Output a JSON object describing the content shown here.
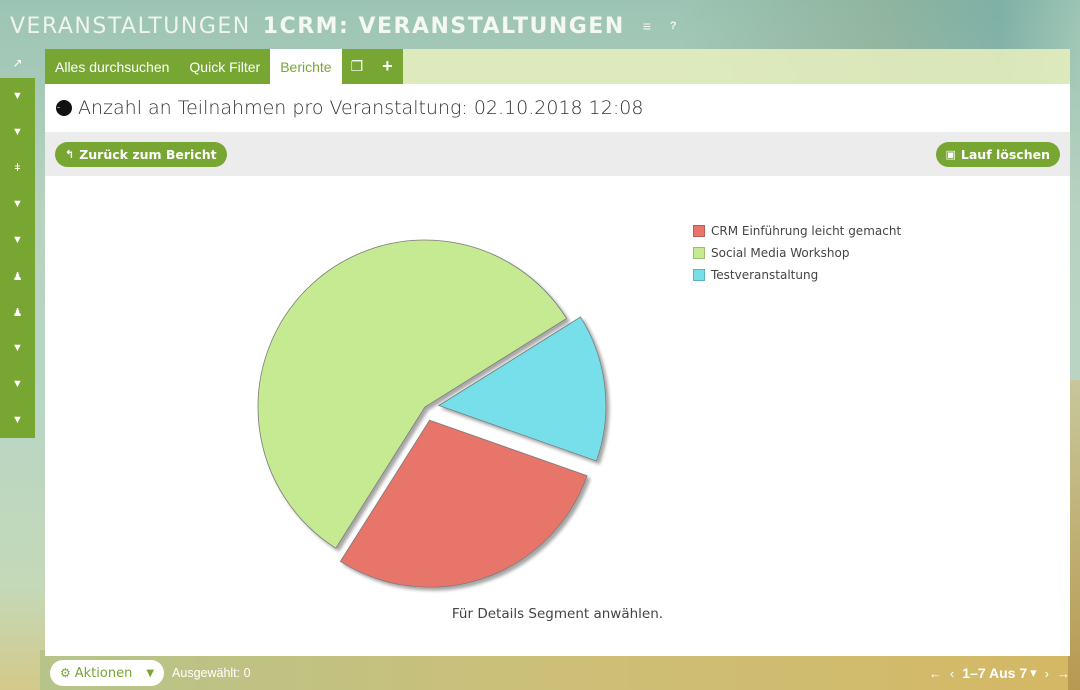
{
  "title": {
    "module": "VERANSTALTUNGEN",
    "record": "1CRM: VERANSTALTUNGEN",
    "menu_icon": "≡",
    "help_icon": "?"
  },
  "sidebar": {
    "top_icon": "↗",
    "items": [
      {
        "icon": "pizza-slice",
        "glyph": "▼"
      },
      {
        "icon": "pizza-slice",
        "glyph": "▼"
      },
      {
        "icon": "pin",
        "glyph": "ǂ"
      },
      {
        "icon": "pizza-slice",
        "glyph": "▼"
      },
      {
        "icon": "pizza-slice",
        "glyph": "▼"
      },
      {
        "icon": "user",
        "glyph": "♟"
      },
      {
        "icon": "user",
        "glyph": "♟"
      },
      {
        "icon": "pizza-slice",
        "glyph": "▼"
      },
      {
        "icon": "pizza-slice",
        "glyph": "▼"
      },
      {
        "icon": "pizza-slice",
        "glyph": "▼"
      }
    ]
  },
  "tabs": {
    "search": "Alles durchsuchen",
    "quick_filter": "Quick Filter",
    "reports": "Berichte",
    "window_icon": "❐",
    "add_icon": "+"
  },
  "header": {
    "title": "Anzahl an Teilnahmen pro Veranstaltung: 02.10.2018 12:08"
  },
  "toolbar": {
    "back_label": "Zurück zum Bericht",
    "back_icon": "↰",
    "delete_label": "Lauf löschen",
    "delete_icon": "🗑"
  },
  "hint": "Für Details Segment anwählen.",
  "footer": {
    "actions_label": "Aktionen",
    "actions_icon": "⚙",
    "caret": "▼",
    "selected": "Ausgewählt: 0",
    "first": "←",
    "prev": "‹",
    "range": "1–7 Aus 7",
    "range_caret": "▾",
    "next": "›",
    "last": "→"
  },
  "chart_data": {
    "type": "pie",
    "title": "Anzahl an Teilnahmen pro Veranstaltung",
    "legend_position": "top-right",
    "categories": [
      "CRM Einführung leicht gemacht",
      "Social Media Workshop",
      "Testveranstaltung"
    ],
    "values": [
      2,
      4,
      1
    ],
    "colors": [
      "#e8746a",
      "#c6ea91",
      "#76dfe9"
    ],
    "exploded": [
      true,
      false,
      true
    ]
  }
}
